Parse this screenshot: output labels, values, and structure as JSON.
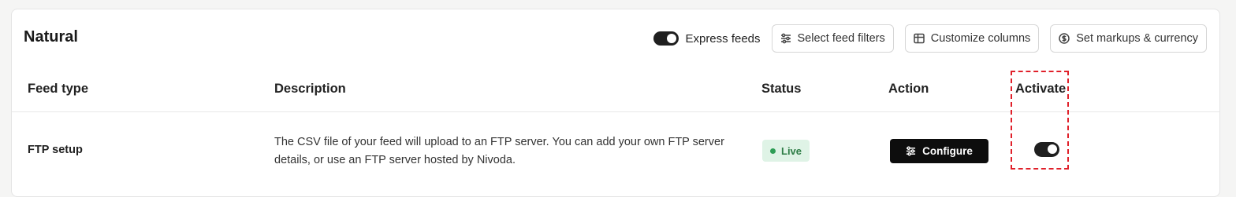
{
  "page": {
    "title": "Natural"
  },
  "toolbar": {
    "express_feeds_label": "Express feeds",
    "express_feeds_on": true,
    "select_filters_label": "Select feed filters",
    "customize_columns_label": "Customize columns",
    "markups_label": "Set markups & currency"
  },
  "table": {
    "headers": {
      "feed_type": "Feed type",
      "description": "Description",
      "status": "Status",
      "action": "Action",
      "activate": "Activate"
    },
    "rows": [
      {
        "feed_type": "FTP setup",
        "description": "The CSV file of your feed will upload to an FTP server. You can add your own FTP server details, or use an FTP server hosted by Nivoda.",
        "status": "Live",
        "action_label": "Configure",
        "active": true
      }
    ]
  },
  "colors": {
    "accent": "#0d0d0d",
    "live_bg": "#dff3e6",
    "live_text": "#2e7d46",
    "highlight": "#e0202a"
  }
}
